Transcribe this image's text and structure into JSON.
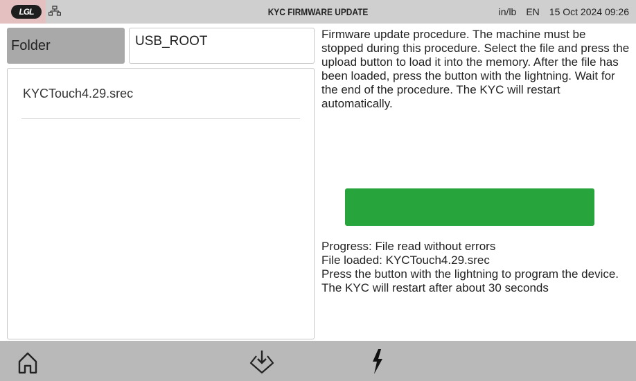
{
  "header": {
    "title": "KYC FIRMWARE UPDATE",
    "logo_text": "LGL",
    "units": "in/lb",
    "language": "EN",
    "datetime": "15 Oct 2024 09:26",
    "network_icon": "network-icon"
  },
  "folder": {
    "label": "Folder",
    "value": "USB_ROOT"
  },
  "files": [
    {
      "name": "KYCTouch4.29.srec"
    }
  ],
  "instructions": "Firmware update procedure. The machine must be stopped during this procedure. Select the file and press the upload button to load it into the memory. After the file has been loaded, press the button with the lightning. Wait for the end of the procedure. The KYC will restart automatically.",
  "progress": {
    "fraction": 1.0,
    "color": "#27a43c"
  },
  "status": {
    "line1": "Progress: File read without errors",
    "line2": "File loaded: KYCTouch4.29.srec",
    "line3": "Press the button with the lightning to program the device.",
    "line4": "The KYC will restart after about 30 seconds"
  },
  "footer": {
    "home_icon": "home-icon",
    "upload_icon": "upload-icon",
    "lightning_icon": "lightning-icon"
  },
  "colors": {
    "topbar": "#cfcfcf",
    "bottombar": "#b9b9b9",
    "accent_green": "#27a43c"
  }
}
